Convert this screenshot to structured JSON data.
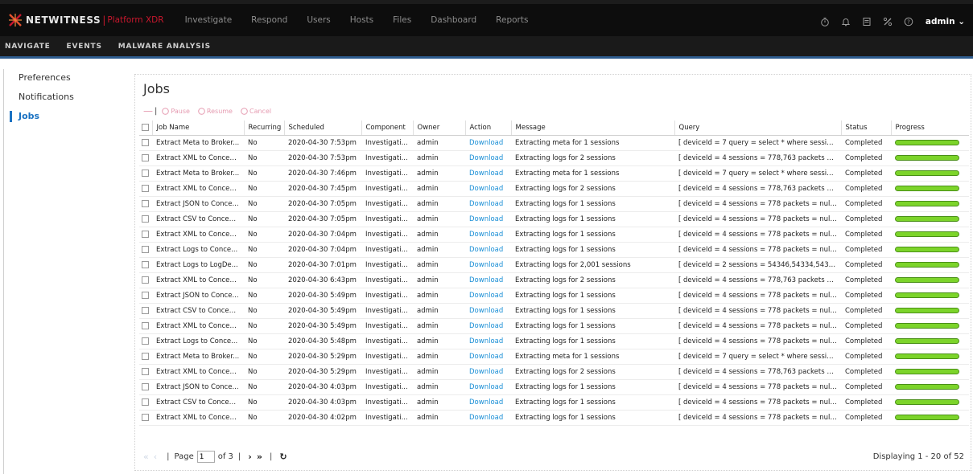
{
  "app": {
    "brand_name": "NETWITNESS",
    "brand_sep": "|",
    "brand_product": "Platform XDR",
    "accent_color": "#c8172d",
    "link_color": "#1a8fd6",
    "progress_color": "#7cd42a"
  },
  "main_nav": [
    "Investigate",
    "Respond",
    "Users",
    "Hosts",
    "Files",
    "Dashboard",
    "Reports"
  ],
  "top_right": {
    "icons": [
      "timer-icon",
      "bell-icon",
      "notes-icon",
      "tools-icon",
      "help-icon"
    ],
    "user": "admin ⌄"
  },
  "sub_nav": [
    "NAVIGATE",
    "EVENTS",
    "MALWARE ANALYSIS"
  ],
  "left_panel": {
    "items": [
      {
        "label": "Preferences",
        "active": false
      },
      {
        "label": "Notifications",
        "active": false
      },
      {
        "label": "Jobs",
        "active": true
      }
    ]
  },
  "jobs": {
    "title": "Jobs",
    "toolbar": {
      "minus": "—",
      "sep": "|",
      "pause": "Pause",
      "resume": "Resume",
      "cancel": "Cancel"
    },
    "columns": [
      "Job Name",
      "Recurring",
      "Scheduled",
      "Component",
      "Owner",
      "Action",
      "Message",
      "Query",
      "Status",
      "Progress"
    ],
    "rows": [
      {
        "name": "Extract Meta to Broker...",
        "recurring": "No",
        "scheduled": "2020-04-30 7:53pm",
        "component": "Investigati...",
        "owner": "admin",
        "action": "Download",
        "message": "Extracting meta for 1 sessions",
        "query": "[ deviceId = 7 query = select * where sessio...",
        "status": "Completed",
        "progress": 100
      },
      {
        "name": "Extract XML to Concen...",
        "recurring": "No",
        "scheduled": "2020-04-30 7:53pm",
        "component": "Investigati...",
        "owner": "admin",
        "action": "Download",
        "message": "Extracting logs for 2 sessions",
        "query": "[ deviceId = 4 sessions = 778,763 packets = ...",
        "status": "Completed",
        "progress": 100
      },
      {
        "name": "Extract Meta to Broker...",
        "recurring": "No",
        "scheduled": "2020-04-30 7:46pm",
        "component": "Investigati...",
        "owner": "admin",
        "action": "Download",
        "message": "Extracting meta for 1 sessions",
        "query": "[ deviceId = 7 query = select * where sessio...",
        "status": "Completed",
        "progress": 100
      },
      {
        "name": "Extract XML to Concen...",
        "recurring": "No",
        "scheduled": "2020-04-30 7:45pm",
        "component": "Investigati...",
        "owner": "admin",
        "action": "Download",
        "message": "Extracting logs for 2 sessions",
        "query": "[ deviceId = 4 sessions = 778,763 packets = ...",
        "status": "Completed",
        "progress": 100
      },
      {
        "name": "Extract JSON to Conce...",
        "recurring": "No",
        "scheduled": "2020-04-30 7:05pm",
        "component": "Investigati...",
        "owner": "admin",
        "action": "Download",
        "message": "Extracting logs for 1 sessions",
        "query": "[ deviceId = 4 sessions = 778 packets = null ...",
        "status": "Completed",
        "progress": 100
      },
      {
        "name": "Extract CSV to Concen...",
        "recurring": "No",
        "scheduled": "2020-04-30 7:05pm",
        "component": "Investigati...",
        "owner": "admin",
        "action": "Download",
        "message": "Extracting logs for 1 sessions",
        "query": "[ deviceId = 4 sessions = 778 packets = null ...",
        "status": "Completed",
        "progress": 100
      },
      {
        "name": "Extract XML to Concen...",
        "recurring": "No",
        "scheduled": "2020-04-30 7:04pm",
        "component": "Investigati...",
        "owner": "admin",
        "action": "Download",
        "message": "Extracting logs for 1 sessions",
        "query": "[ deviceId = 4 sessions = 778 packets = null ...",
        "status": "Completed",
        "progress": 100
      },
      {
        "name": "Extract Logs to Conce...",
        "recurring": "No",
        "scheduled": "2020-04-30 7:04pm",
        "component": "Investigati...",
        "owner": "admin",
        "action": "Download",
        "message": "Extracting logs for 1 sessions",
        "query": "[ deviceId = 4 sessions = 778 packets = null ...",
        "status": "Completed",
        "progress": 100
      },
      {
        "name": "Extract Logs to LogDe...",
        "recurring": "No",
        "scheduled": "2020-04-30 7:01pm",
        "component": "Investigati...",
        "owner": "admin",
        "action": "Download",
        "message": "Extracting logs for 2,001 sessions",
        "query": "[ deviceId = 2 sessions = 54346,54334,5433...",
        "status": "Completed",
        "progress": 100
      },
      {
        "name": "Extract XML to Concen...",
        "recurring": "No",
        "scheduled": "2020-04-30 6:43pm",
        "component": "Investigati...",
        "owner": "admin",
        "action": "Download",
        "message": "Extracting logs for 2 sessions",
        "query": "[ deviceId = 4 sessions = 778,763 packets = ...",
        "status": "Completed",
        "progress": 100
      },
      {
        "name": "Extract JSON to Conce...",
        "recurring": "No",
        "scheduled": "2020-04-30 5:49pm",
        "component": "Investigati...",
        "owner": "admin",
        "action": "Download",
        "message": "Extracting logs for 1 sessions",
        "query": "[ deviceId = 4 sessions = 778 packets = null ...",
        "status": "Completed",
        "progress": 100
      },
      {
        "name": "Extract CSV to Concen...",
        "recurring": "No",
        "scheduled": "2020-04-30 5:49pm",
        "component": "Investigati...",
        "owner": "admin",
        "action": "Download",
        "message": "Extracting logs for 1 sessions",
        "query": "[ deviceId = 4 sessions = 778 packets = null ...",
        "status": "Completed",
        "progress": 100
      },
      {
        "name": "Extract XML to Concen...",
        "recurring": "No",
        "scheduled": "2020-04-30 5:49pm",
        "component": "Investigati...",
        "owner": "admin",
        "action": "Download",
        "message": "Extracting logs for 1 sessions",
        "query": "[ deviceId = 4 sessions = 778 packets = null ...",
        "status": "Completed",
        "progress": 100
      },
      {
        "name": "Extract Logs to Conce...",
        "recurring": "No",
        "scheduled": "2020-04-30 5:48pm",
        "component": "Investigati...",
        "owner": "admin",
        "action": "Download",
        "message": "Extracting logs for 1 sessions",
        "query": "[ deviceId = 4 sessions = 778 packets = null ...",
        "status": "Completed",
        "progress": 100
      },
      {
        "name": "Extract Meta to Broker...",
        "recurring": "No",
        "scheduled": "2020-04-30 5:29pm",
        "component": "Investigati...",
        "owner": "admin",
        "action": "Download",
        "message": "Extracting meta for 1 sessions",
        "query": "[ deviceId = 7 query = select * where sessio...",
        "status": "Completed",
        "progress": 100
      },
      {
        "name": "Extract XML to Concen...",
        "recurring": "No",
        "scheduled": "2020-04-30 5:29pm",
        "component": "Investigati...",
        "owner": "admin",
        "action": "Download",
        "message": "Extracting logs for 2 sessions",
        "query": "[ deviceId = 4 sessions = 778,763 packets = ...",
        "status": "Completed",
        "progress": 100
      },
      {
        "name": "Extract JSON to Conce...",
        "recurring": "No",
        "scheduled": "2020-04-30 4:03pm",
        "component": "Investigati...",
        "owner": "admin",
        "action": "Download",
        "message": "Extracting logs for 1 sessions",
        "query": "[ deviceId = 4 sessions = 778 packets = null ...",
        "status": "Completed",
        "progress": 100
      },
      {
        "name": "Extract CSV to Concen...",
        "recurring": "No",
        "scheduled": "2020-04-30 4:03pm",
        "component": "Investigati...",
        "owner": "admin",
        "action": "Download",
        "message": "Extracting logs for 1 sessions",
        "query": "[ deviceId = 4 sessions = 778 packets = null ...",
        "status": "Completed",
        "progress": 100
      },
      {
        "name": "Extract XML to Concen...",
        "recurring": "No",
        "scheduled": "2020-04-30 4:02pm",
        "component": "Investigati...",
        "owner": "admin",
        "action": "Download",
        "message": "Extracting logs for 1 sessions",
        "query": "[ deviceId = 4 sessions = 778 packets = null ...",
        "status": "Completed",
        "progress": 100
      }
    ],
    "pager": {
      "first": "«",
      "prev": "‹",
      "sep": "|",
      "page_label": "Page",
      "page_value": "1",
      "of_label": "of 3",
      "next": "›",
      "last": "»",
      "refresh": "↻",
      "display": "Displaying 1 - 20 of 52"
    }
  }
}
